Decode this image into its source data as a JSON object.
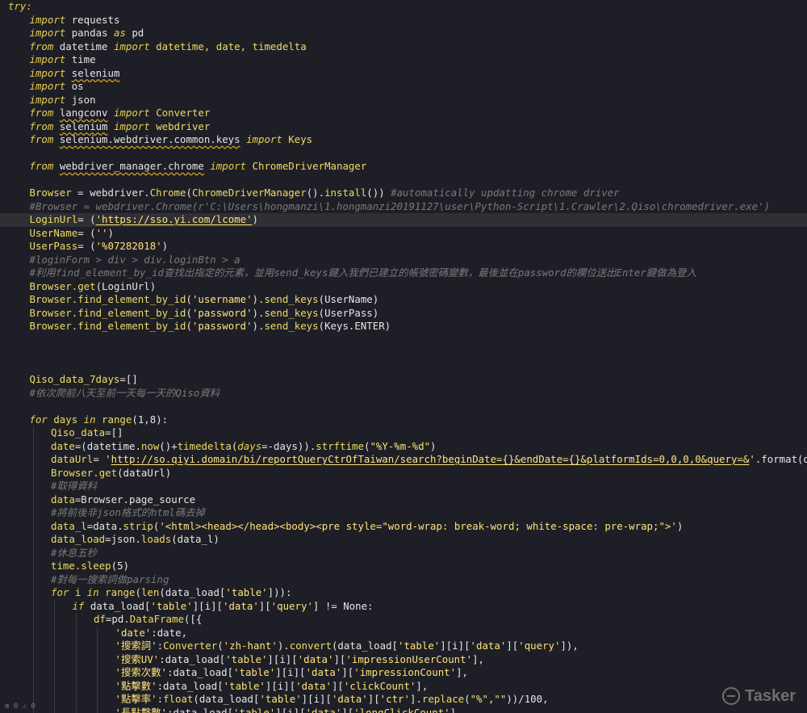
{
  "editor": {
    "lines": [
      {
        "i": 0,
        "t": [
          [
            "try:",
            "kw"
          ]
        ]
      },
      {
        "i": 1,
        "t": [
          [
            "import",
            "kw"
          ],
          [
            " requests",
            "mod"
          ]
        ]
      },
      {
        "i": 1,
        "t": [
          [
            "import",
            "kw"
          ],
          [
            " pandas ",
            "mod"
          ],
          [
            "as",
            "kw"
          ],
          [
            " pd",
            "mod"
          ]
        ]
      },
      {
        "i": 1,
        "t": [
          [
            "from",
            "kw"
          ],
          [
            " datetime ",
            "mod"
          ],
          [
            "import",
            "kw"
          ],
          [
            " datetime, date, timedelta",
            "id"
          ]
        ]
      },
      {
        "i": 1,
        "t": [
          [
            "import",
            "kw"
          ],
          [
            " time",
            "mod"
          ]
        ]
      },
      {
        "i": 1,
        "t": [
          [
            "import",
            "kw"
          ],
          [
            " ",
            "mod"
          ],
          [
            "selenium",
            "mod sq"
          ]
        ]
      },
      {
        "i": 1,
        "t": [
          [
            "import",
            "kw"
          ],
          [
            " os",
            "mod"
          ]
        ]
      },
      {
        "i": 1,
        "t": [
          [
            "import",
            "kw"
          ],
          [
            " json",
            "mod"
          ]
        ]
      },
      {
        "i": 1,
        "t": [
          [
            "from",
            "kw"
          ],
          [
            " ",
            "mod"
          ],
          [
            "langconv",
            "mod sq"
          ],
          [
            " ",
            "mod"
          ],
          [
            "import",
            "kw"
          ],
          [
            " Converter",
            "id"
          ]
        ]
      },
      {
        "i": 1,
        "t": [
          [
            "from",
            "kw"
          ],
          [
            " ",
            "mod"
          ],
          [
            "selenium",
            "mod sq"
          ],
          [
            " ",
            "mod"
          ],
          [
            "import",
            "kw"
          ],
          [
            " webdriver",
            "id"
          ]
        ]
      },
      {
        "i": 1,
        "t": [
          [
            "from",
            "kw"
          ],
          [
            " ",
            "mod"
          ],
          [
            "selenium.webdriver.common.keys",
            "mod sq"
          ],
          [
            " ",
            "mod"
          ],
          [
            "import",
            "kw"
          ],
          [
            " Keys",
            "id"
          ]
        ]
      },
      {
        "i": 1,
        "t": []
      },
      {
        "i": 1,
        "t": [
          [
            "from",
            "kw"
          ],
          [
            " ",
            "mod"
          ],
          [
            "webdriver_manager.chrome",
            "mod sq"
          ],
          [
            " ",
            "mod"
          ],
          [
            "import",
            "kw"
          ],
          [
            " ChromeDriverManager",
            "id"
          ]
        ]
      },
      {
        "i": 1,
        "t": []
      },
      {
        "i": 1,
        "t": [
          [
            "Browser",
            "id"
          ],
          [
            " = webdriver.",
            "pn"
          ],
          [
            "Chrome",
            "fn"
          ],
          [
            "(",
            "pn"
          ],
          [
            "ChromeDriverManager",
            "fn"
          ],
          [
            "().",
            "pn"
          ],
          [
            "install",
            "fn"
          ],
          [
            "()) ",
            "pn"
          ],
          [
            "#automatically updatting chrome driver",
            "cm"
          ]
        ]
      },
      {
        "i": 1,
        "t": [
          [
            "#Browser = webdriver.Chrome(r'C:\\Users\\hongmanzi\\1.hongmanzi20191127\\user\\Python-Script\\1.Crawler\\2.Qiso\\chromedriver.exe')",
            "cm"
          ]
        ]
      },
      {
        "i": 1,
        "hl": true,
        "t": [
          [
            "LoginUrl",
            "id"
          ],
          [
            "= (",
            "pn"
          ],
          [
            "'https://sso.yi.com/lcome'",
            "str ul"
          ],
          [
            ")",
            "pn"
          ]
        ]
      },
      {
        "i": 1,
        "t": [
          [
            "UserName",
            "id"
          ],
          [
            "= (",
            "pn"
          ],
          [
            "''",
            "str"
          ],
          [
            ")",
            "pn"
          ]
        ]
      },
      {
        "i": 1,
        "t": [
          [
            "UserPass",
            "id"
          ],
          [
            "= (",
            "pn"
          ],
          [
            "'%07282018'",
            "str"
          ],
          [
            ")",
            "pn"
          ]
        ]
      },
      {
        "i": 1,
        "t": [
          [
            "#loginForm > div > div.loginBtn > a",
            "cm"
          ]
        ]
      },
      {
        "i": 1,
        "t": [
          [
            "#利用find_element_by_id查找出指定的元素，並用send_keys鍵入我們已建立的帳號密碼變數，最後並在password的欄位送出Enter鍵做為登入",
            "cm"
          ]
        ]
      },
      {
        "i": 1,
        "t": [
          [
            "Browser.",
            "id"
          ],
          [
            "get",
            "fn"
          ],
          [
            "(LoginUrl)",
            "pn"
          ]
        ]
      },
      {
        "i": 1,
        "t": [
          [
            "Browser.",
            "id"
          ],
          [
            "find_element_by_id",
            "fn"
          ],
          [
            "(",
            "pn"
          ],
          [
            "'username'",
            "str"
          ],
          [
            ").",
            "pn"
          ],
          [
            "send_keys",
            "fn"
          ],
          [
            "(UserName)",
            "pn"
          ]
        ]
      },
      {
        "i": 1,
        "t": [
          [
            "Browser.",
            "id"
          ],
          [
            "find_element_by_id",
            "fn"
          ],
          [
            "(",
            "pn"
          ],
          [
            "'password'",
            "str"
          ],
          [
            ").",
            "pn"
          ],
          [
            "send_keys",
            "fn"
          ],
          [
            "(UserPass)",
            "pn"
          ]
        ]
      },
      {
        "i": 1,
        "t": [
          [
            "Browser.",
            "id"
          ],
          [
            "find_element_by_id",
            "fn"
          ],
          [
            "(",
            "pn"
          ],
          [
            "'password'",
            "str"
          ],
          [
            ").",
            "pn"
          ],
          [
            "send_keys",
            "fn"
          ],
          [
            "(Keys.ENTER)",
            "pn"
          ]
        ]
      },
      {
        "i": 1,
        "t": []
      },
      {
        "i": 1,
        "t": []
      },
      {
        "i": 1,
        "t": []
      },
      {
        "i": 1,
        "t": [
          [
            "Qiso_data_7days",
            "id"
          ],
          [
            "=[]",
            "pn"
          ]
        ]
      },
      {
        "i": 1,
        "t": [
          [
            "#依次爬前八天至前一天每一天的Qiso資料",
            "cm"
          ]
        ]
      },
      {
        "i": 1,
        "t": []
      },
      {
        "i": 1,
        "t": [
          [
            "for",
            "kw"
          ],
          [
            " days ",
            "id"
          ],
          [
            "in",
            "kw"
          ],
          [
            " ",
            "pn"
          ],
          [
            "range",
            "fn"
          ],
          [
            "(1,8):",
            "pn"
          ]
        ]
      },
      {
        "i": 2,
        "t": [
          [
            "Qiso_data",
            "id"
          ],
          [
            "=[]",
            "pn"
          ]
        ]
      },
      {
        "i": 2,
        "t": [
          [
            "date",
            "id"
          ],
          [
            "=(datetime.",
            "pn"
          ],
          [
            "now",
            "fn"
          ],
          [
            "()+",
            "pn"
          ],
          [
            "timedelta",
            "fn"
          ],
          [
            "(",
            "pn"
          ],
          [
            "days",
            "kw"
          ],
          [
            "=-days)).",
            "pn"
          ],
          [
            "strftime",
            "fn"
          ],
          [
            "(",
            "pn"
          ],
          [
            "\"%Y-%m-%d\"",
            "str"
          ],
          [
            ")",
            "pn"
          ]
        ]
      },
      {
        "i": 2,
        "t": [
          [
            "dataUrl",
            "id"
          ],
          [
            "= ",
            "pn"
          ],
          [
            "'",
            "str"
          ],
          [
            "http://so.qiyi.domain/bi/reportQueryCtrOfTaiwan/search?beginDate={}&endDate={}&platformIds=0,0,0,0&query=&",
            "str ul"
          ],
          [
            "'",
            "str"
          ],
          [
            ".format(date,date)",
            "pn"
          ]
        ]
      },
      {
        "i": 2,
        "t": [
          [
            "Browser.",
            "id"
          ],
          [
            "get",
            "fn"
          ],
          [
            "(dataUrl)",
            "pn"
          ]
        ]
      },
      {
        "i": 2,
        "t": [
          [
            "#取得資料",
            "cm"
          ]
        ]
      },
      {
        "i": 2,
        "t": [
          [
            "data",
            "id"
          ],
          [
            "=Browser.page_source",
            "pn"
          ]
        ]
      },
      {
        "i": 2,
        "t": [
          [
            "#將前後非json格式的html碼去掉",
            "cm"
          ]
        ]
      },
      {
        "i": 2,
        "t": [
          [
            "data_l",
            "id"
          ],
          [
            "=data.",
            "pn"
          ],
          [
            "strip",
            "fn"
          ],
          [
            "(",
            "pn"
          ],
          [
            "'<html><head></head><body><pre style=\"word-wrap: break-word; white-space: pre-wrap;\">'",
            "str"
          ],
          [
            ")",
            "pn"
          ]
        ]
      },
      {
        "i": 2,
        "t": [
          [
            "data_load",
            "id"
          ],
          [
            "=json.",
            "pn"
          ],
          [
            "loads",
            "fn"
          ],
          [
            "(data_l)",
            "pn"
          ]
        ]
      },
      {
        "i": 2,
        "t": [
          [
            "#休息五秒",
            "cm"
          ]
        ]
      },
      {
        "i": 2,
        "t": [
          [
            "time.",
            "id"
          ],
          [
            "sleep",
            "fn"
          ],
          [
            "(5)",
            "pn"
          ]
        ]
      },
      {
        "i": 2,
        "t": [
          [
            "#對每一搜索詞做parsing",
            "cm"
          ]
        ]
      },
      {
        "i": 2,
        "t": [
          [
            "for",
            "kw"
          ],
          [
            " i ",
            "id"
          ],
          [
            "in",
            "kw"
          ],
          [
            " ",
            "pn"
          ],
          [
            "range",
            "fn"
          ],
          [
            "(",
            "pn"
          ],
          [
            "len",
            "fn"
          ],
          [
            "(data_load[",
            "pn"
          ],
          [
            "'table'",
            "str"
          ],
          [
            "])):",
            "pn"
          ]
        ]
      },
      {
        "i": 3,
        "t": [
          [
            "if",
            "kw"
          ],
          [
            " data_load[",
            "pn"
          ],
          [
            "'table'",
            "str"
          ],
          [
            "][i][",
            "pn"
          ],
          [
            "'data'",
            "str"
          ],
          [
            "][",
            "pn"
          ],
          [
            "'query'",
            "str"
          ],
          [
            "] != None:",
            "pn"
          ]
        ]
      },
      {
        "i": 4,
        "t": [
          [
            "df",
            "id"
          ],
          [
            "=pd.",
            "pn"
          ],
          [
            "DataFrame",
            "fn"
          ],
          [
            "([{",
            "pn"
          ]
        ]
      },
      {
        "i": 5,
        "t": [
          [
            "'date'",
            "str"
          ],
          [
            ":date,",
            "pn"
          ]
        ]
      },
      {
        "i": 5,
        "t": [
          [
            "'搜索詞'",
            "str"
          ],
          [
            ":",
            "pn"
          ],
          [
            "Converter",
            "fn"
          ],
          [
            "(",
            "pn"
          ],
          [
            "'zh-hant'",
            "str"
          ],
          [
            ").",
            "pn"
          ],
          [
            "convert",
            "fn"
          ],
          [
            "(data_load[",
            "pn"
          ],
          [
            "'table'",
            "str"
          ],
          [
            "][i][",
            "pn"
          ],
          [
            "'data'",
            "str"
          ],
          [
            "][",
            "pn"
          ],
          [
            "'query'",
            "str"
          ],
          [
            "]),",
            "pn"
          ]
        ]
      },
      {
        "i": 5,
        "t": [
          [
            "'搜索UV'",
            "str"
          ],
          [
            ":data_load[",
            "pn"
          ],
          [
            "'table'",
            "str"
          ],
          [
            "][i][",
            "pn"
          ],
          [
            "'data'",
            "str"
          ],
          [
            "][",
            "pn"
          ],
          [
            "'impressionUserCount'",
            "str"
          ],
          [
            "],",
            "pn"
          ]
        ]
      },
      {
        "i": 5,
        "t": [
          [
            "'搜索次數'",
            "str"
          ],
          [
            ":data_load[",
            "pn"
          ],
          [
            "'table'",
            "str"
          ],
          [
            "][i][",
            "pn"
          ],
          [
            "'data'",
            "str"
          ],
          [
            "][",
            "pn"
          ],
          [
            "'impressionCount'",
            "str"
          ],
          [
            "],",
            "pn"
          ]
        ]
      },
      {
        "i": 5,
        "t": [
          [
            "'點擊數'",
            "str"
          ],
          [
            ":data_load[",
            "pn"
          ],
          [
            "'table'",
            "str"
          ],
          [
            "][i][",
            "pn"
          ],
          [
            "'data'",
            "str"
          ],
          [
            "][",
            "pn"
          ],
          [
            "'clickCount'",
            "str"
          ],
          [
            "],",
            "pn"
          ]
        ]
      },
      {
        "i": 5,
        "t": [
          [
            "'點擊率'",
            "str"
          ],
          [
            ":",
            "pn"
          ],
          [
            "float",
            "fn"
          ],
          [
            "(data_load[",
            "pn"
          ],
          [
            "'table'",
            "str"
          ],
          [
            "][i][",
            "pn"
          ],
          [
            "'data'",
            "str"
          ],
          [
            "][",
            "pn"
          ],
          [
            "'ctr'",
            "str"
          ],
          [
            "].",
            "pn"
          ],
          [
            "replace",
            "fn"
          ],
          [
            "(",
            "pn"
          ],
          [
            "\"%\",\"\"",
            "str"
          ],
          [
            "))/100,",
            "pn"
          ]
        ]
      },
      {
        "i": 5,
        "t": [
          [
            "'長點擊數'",
            "str"
          ],
          [
            ":data load[",
            "pn"
          ],
          [
            "'table'",
            "str"
          ],
          [
            "][i][",
            "pn"
          ],
          [
            "'data'",
            "str"
          ],
          [
            "][",
            "pn"
          ],
          [
            "'longClickCount'",
            "str"
          ],
          [
            "],",
            "pn"
          ]
        ]
      }
    ]
  },
  "watermark": {
    "text": "Tasker",
    "icon": "tasker-logo-icon"
  },
  "status": {
    "text": "⊗ 0  ⚠ 0"
  },
  "colors": {
    "background": "#1e1f26",
    "keyword": "#e8ce4f",
    "string": "#ffe27a",
    "comment": "#7a7a7a",
    "highlight": "#2f3033"
  }
}
